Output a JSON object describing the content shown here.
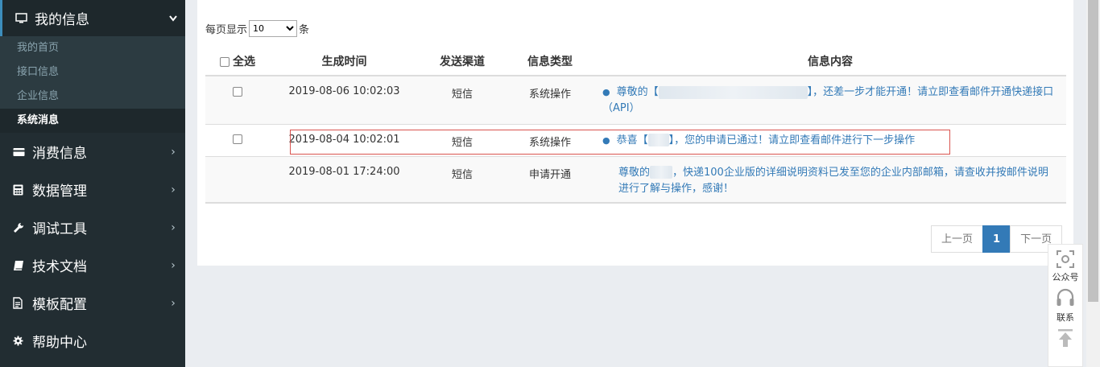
{
  "sidebar": {
    "active_menu": {
      "label": "我的信息",
      "icon": "monitor-icon"
    },
    "sub_items": [
      "我的首页",
      "接口信息",
      "企业信息",
      "系统消息"
    ],
    "active_sub": "系统消息",
    "menus": [
      {
        "label": "消费信息",
        "icon": "credit-card-icon"
      },
      {
        "label": "数据管理",
        "icon": "calculator-icon"
      },
      {
        "label": "调试工具",
        "icon": "wrench-icon"
      },
      {
        "label": "技术文档",
        "icon": "book-icon"
      },
      {
        "label": "模板配置",
        "icon": "document-icon"
      },
      {
        "label": "帮助中心",
        "icon": "gear-icon"
      }
    ]
  },
  "perpage": {
    "prefix": "每页显示",
    "value": "10",
    "suffix": "条"
  },
  "table": {
    "headers": {
      "select_all": "全选",
      "time": "生成时间",
      "channel": "发送渠道",
      "type": "信息类型",
      "content": "信息内容"
    },
    "rows": [
      {
        "time": "2019-08-06 10:02:03",
        "channel": "短信",
        "type": "系统操作",
        "content_a": "尊敬的【",
        "content_b": "】，还差一步才能开通！请立即查看邮件开通快递接口（API）",
        "has_checkbox": true
      },
      {
        "time": "2019-08-04 10:02:01",
        "channel": "短信",
        "type": "系统操作",
        "content_a": "恭喜【",
        "content_b": "】，您的申请已通过！请立即查看邮件进行下一步操作",
        "has_checkbox": true
      },
      {
        "time": "2019-08-01 17:24:00",
        "channel": "短信",
        "type": "申请开通",
        "content_a": "尊敬的",
        "content_b": "，快递100企业版的详细说明资料已发至您的企业内部邮箱，请查收并按邮件说明进行了解与操作，感谢！",
        "has_checkbox": false
      }
    ]
  },
  "pager": {
    "prev": "上一页",
    "current": "1",
    "next": "下一页"
  },
  "float_tools": {
    "wechat": "公众号",
    "contact": "联系",
    "top_icon": "arrow-up-icon"
  },
  "colors": {
    "sidebar_bg": "#222d32",
    "accent": "#3c8dbc",
    "link": "#337ab7",
    "highlight_border": "#d9534f"
  }
}
